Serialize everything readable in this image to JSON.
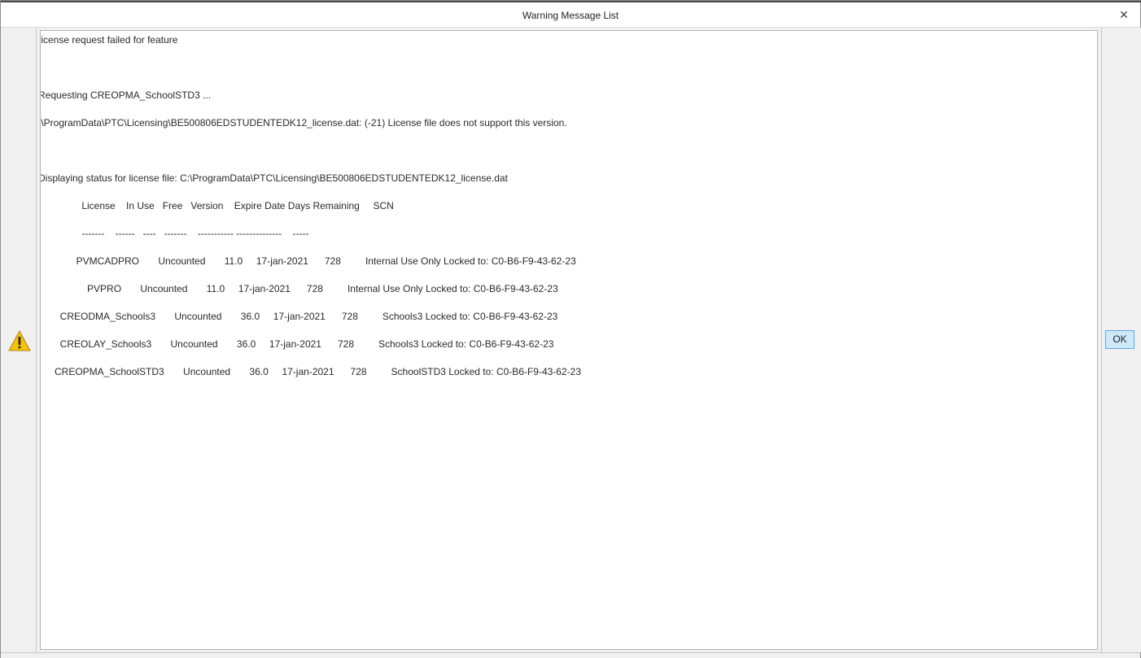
{
  "window": {
    "title": "Warning Message List",
    "close_glyph": "✕",
    "close_icon": "close-icon"
  },
  "icons": {
    "warning": "warning-triangle-icon"
  },
  "colors": {
    "warning_fill": "#f4c20d",
    "ok_button_bg": "#cde8fb",
    "ok_button_border": "#5fa8dc"
  },
  "messages": [
    ".icense request failed for feature",
    "Requesting CREOPMA_SchoolSTD3 ...",
    ":\\ProgramData\\PTC\\Licensing\\BE500806EDSTUDENTEDK12_license.dat: (-21) License file does not support this version.",
    "Displaying status for license file: C:\\ProgramData\\PTC\\Licensing\\BE500806EDSTUDENTEDK12_license.dat",
    "                License    In Use   Free   Version    Expire Date Days Remaining     SCN",
    "                -------    ------   ----   -------    ----------- --------------    -----",
    "              PVMCADPRO       Uncounted       11.0     17-jan-2021      728         Internal Use Only Locked to: C0-B6-F9-43-62-23",
    "                  PVPRO       Uncounted       11.0     17-jan-2021      728         Internal Use Only Locked to: C0-B6-F9-43-62-23",
    "        CREODMA_Schools3       Uncounted       36.0     17-jan-2021      728         Schools3 Locked to: C0-B6-F9-43-62-23",
    "        CREOLAY_Schools3       Uncounted       36.0     17-jan-2021      728         Schools3 Locked to: C0-B6-F9-43-62-23",
    "      CREOPMA_SchoolSTD3       Uncounted       36.0     17-jan-2021      728         SchoolSTD3 Locked to: C0-B6-F9-43-62-23"
  ],
  "buttons": {
    "ok_label": "OK"
  }
}
